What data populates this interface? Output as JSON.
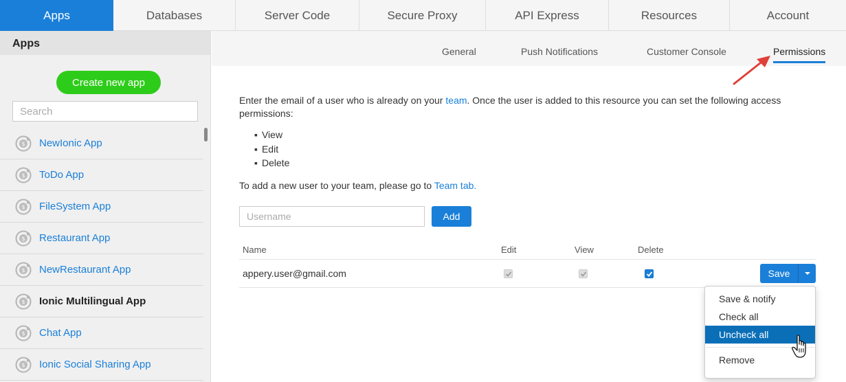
{
  "topnav": {
    "tabs": [
      {
        "label": "Apps",
        "active": true
      },
      {
        "label": "Databases"
      },
      {
        "label": "Server Code"
      },
      {
        "label": "Secure Proxy"
      },
      {
        "label": "API Express"
      },
      {
        "label": "Resources"
      },
      {
        "label": "Account"
      }
    ]
  },
  "sidebar": {
    "title": "Apps",
    "create_label": "Create new app",
    "search_placeholder": "Search",
    "items": [
      {
        "label": "NewIonic App",
        "icon": "ionic-app-icon"
      },
      {
        "label": "ToDo App",
        "icon": "ionic-app-icon"
      },
      {
        "label": "FileSystem App",
        "icon": "ionic-app-icon"
      },
      {
        "label": "Restaurant App",
        "icon": "ionic-app-icon"
      },
      {
        "label": "NewRestaurant App",
        "icon": "ionic-app-icon"
      },
      {
        "label": "Ionic Multilingual App",
        "icon": "ionic-app-icon",
        "selected": true
      },
      {
        "label": "Chat App",
        "icon": "ionic-app-icon"
      },
      {
        "label": "Ionic Social Sharing App",
        "icon": "ionic-app-icon"
      }
    ]
  },
  "subnav": {
    "tabs": [
      {
        "label": "General"
      },
      {
        "label": "Push Notifications"
      },
      {
        "label": "Customer Console"
      },
      {
        "label": "Permissions",
        "active": true
      }
    ]
  },
  "main": {
    "intro_before": "Enter the email of a user who is already on your ",
    "intro_link": "team",
    "intro_after": ". Once the user is added to this resource you can set the following access permissions:",
    "permissions": [
      "View",
      "Edit",
      "Delete"
    ],
    "team_before": "To add a new user to your team, please go to ",
    "team_link": "Team tab.",
    "username_placeholder": "Username",
    "add_label": "Add",
    "table": {
      "headers": [
        "Name",
        "Edit",
        "View",
        "Delete"
      ],
      "rows": [
        {
          "email": "appery.user@gmail.com",
          "edit": true,
          "view": true,
          "delete": true
        }
      ]
    },
    "save_label": "Save",
    "menu": [
      "Save & notify",
      "Check all",
      "Uncheck all",
      "Remove"
    ]
  },
  "colors": {
    "accent": "#1a7fd8",
    "create_button": "#2ecc1a",
    "menu_highlight": "#0b6fb8",
    "arrow": "#e0403a"
  }
}
